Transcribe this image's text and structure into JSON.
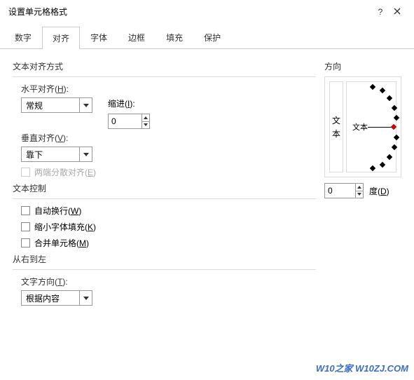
{
  "title": "设置单元格格式",
  "help_char": "?",
  "tabs": [
    "数字",
    "对齐",
    "字体",
    "边框",
    "填充",
    "保护"
  ],
  "active_tab": 1,
  "align": {
    "section": "文本对齐方式",
    "h_label": "水平对齐(",
    "h_key": "H",
    "h_suffix": "):",
    "h_value": "常规",
    "indent_label": "缩进(",
    "indent_key": "I",
    "indent_suffix": "):",
    "indent_value": "0",
    "v_label": "垂直对齐(",
    "v_key": "V",
    "v_suffix": "):",
    "v_value": "靠下",
    "justify_label": "两端分散对齐(",
    "justify_key": "E",
    "justify_suffix": ")"
  },
  "textctl": {
    "section": "文本控制",
    "wrap_label": "自动换行(",
    "wrap_key": "W",
    "wrap_suffix": ")",
    "shrink_label": "缩小字体填充(",
    "shrink_key": "K",
    "shrink_suffix": ")",
    "merge_label": "合并单元格(",
    "merge_key": "M",
    "merge_suffix": ")"
  },
  "rtl": {
    "section": "从右到左",
    "dir_label": "文字方向(",
    "dir_key": "T",
    "dir_suffix": "):",
    "dir_value": "根据内容"
  },
  "orient": {
    "section": "方向",
    "vtext1": "文",
    "vtext2": "本",
    "dial_text": "文本",
    "deg_value": "0",
    "deg_label": "度(",
    "deg_key": "D",
    "deg_suffix": ")"
  },
  "watermark": "W10之家 W10ZJ.COM"
}
